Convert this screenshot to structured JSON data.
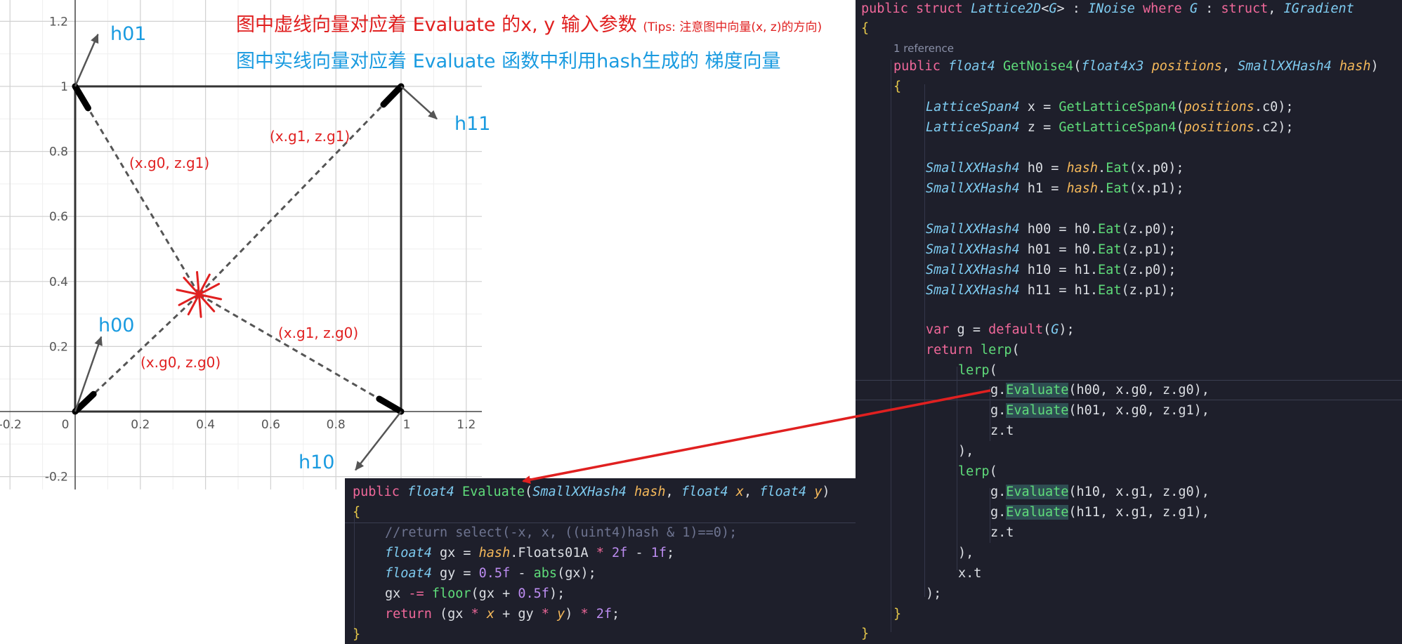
{
  "plot": {
    "x_ticks": [
      "-0.2",
      "0",
      "0.2",
      "0.4",
      "0.6",
      "0.8",
      "1",
      "1.2"
    ],
    "y_ticks": [
      "1.2",
      "1",
      "0.8",
      "0.6",
      "0.4",
      "0.2",
      "-0.2"
    ],
    "labels": {
      "h00": "h00",
      "h01": "h01",
      "h10": "h10",
      "h11": "h11",
      "g00": "(x.g0, z.g0)",
      "g01": "(x.g0, z.g1)",
      "g10": "(x.g1, z.g0)",
      "g11": "(x.g1, z.g1)"
    },
    "point": {
      "x": 0.38,
      "y": 0.36
    },
    "gradients": {
      "h00": {
        "from": [
          0,
          0
        ],
        "to": [
          0.08,
          0.23
        ]
      },
      "h01": {
        "from": [
          0,
          1
        ],
        "to": [
          0.07,
          1.16
        ]
      },
      "h10": {
        "from": [
          1,
          0
        ],
        "to": [
          0.86,
          -0.18
        ]
      },
      "h11": {
        "from": [
          1,
          1
        ],
        "to": [
          1.11,
          0.9
        ]
      }
    }
  },
  "annotations": {
    "line1": "图中虚线向量对应着 Evaluate 的x, y 输入参数",
    "line1_tips": "(Tips: 注意图中向量(x, z)的方向)",
    "line2": "图中实线向量对应着 Evaluate 函数中利用hash生成的 梯度向量"
  },
  "code_right": {
    "reference": "1 reference"
  },
  "colors": {
    "annotation_red": "#e02020",
    "annotation_blue": "#1a9be0",
    "code_bg": "#1e1f2b",
    "arrow": "#e02020"
  }
}
